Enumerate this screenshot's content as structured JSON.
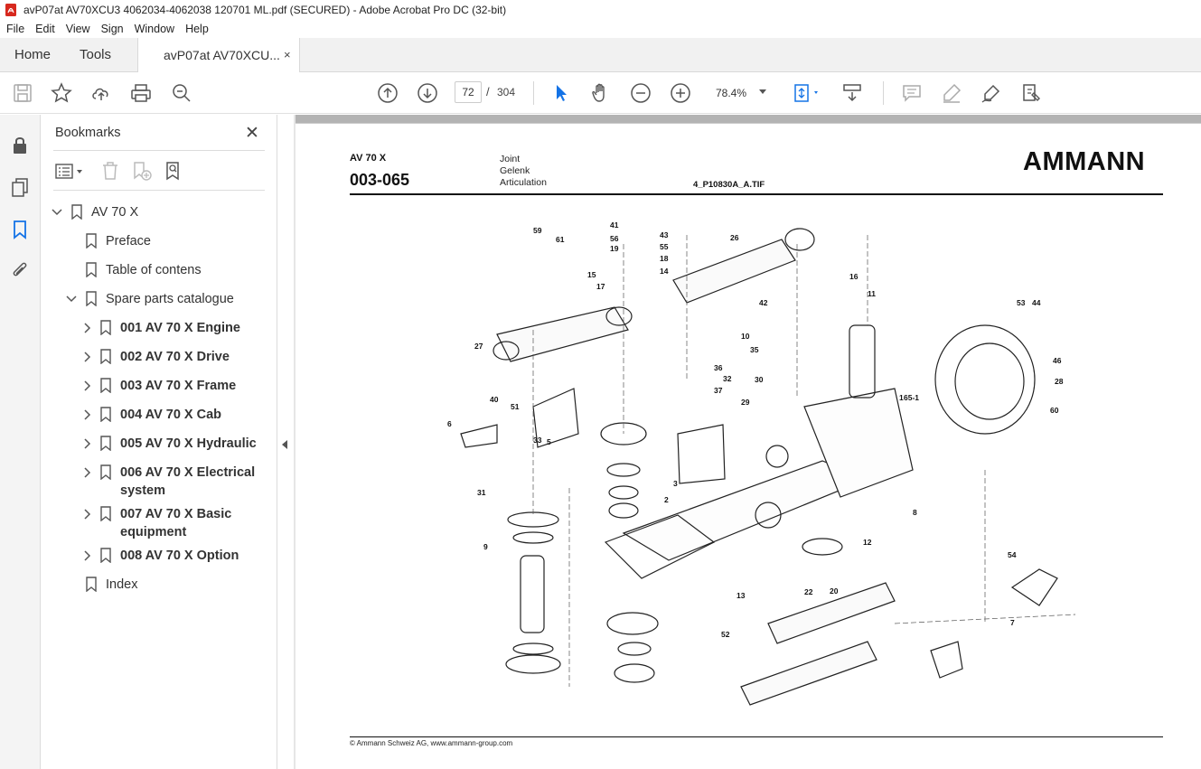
{
  "window": {
    "title": "avP07at AV70XCU3 4062034-4062038 120701 ML.pdf (SECURED) - Adobe Acrobat Pro DC (32-bit)"
  },
  "menu": [
    "File",
    "Edit",
    "View",
    "Sign",
    "Window",
    "Help"
  ],
  "tabs": {
    "home": "Home",
    "tools": "Tools",
    "document": "avP07at AV70XCU...",
    "close_glyph": "×"
  },
  "toolbar": {
    "page_current": "72",
    "page_separator": "/",
    "page_total": "304",
    "zoom": "78.4%"
  },
  "bookmarks": {
    "title": "Bookmarks",
    "close_glyph": "✕",
    "items": [
      {
        "label": "AV 70 X",
        "expanded": true,
        "bold": false
      },
      {
        "label": "Preface",
        "bold": false
      },
      {
        "label": "Table of contens",
        "bold": false
      },
      {
        "label": "Spare parts catalogue",
        "expanded": true,
        "bold": false
      },
      {
        "label": "001  AV 70 X Engine",
        "bold": true
      },
      {
        "label": "002  AV 70 X Drive",
        "bold": true
      },
      {
        "label": "003  AV 70 X Frame",
        "bold": true
      },
      {
        "label": "004  AV 70 X Cab",
        "bold": true
      },
      {
        "label": "005  AV 70 X Hydraulic",
        "bold": true
      },
      {
        "label": "006  AV 70 X Electrical",
        "label2": "system",
        "bold": true
      },
      {
        "label": "007  AV 70 X Basic",
        "label2": "equipment",
        "bold": true
      },
      {
        "label": "008  AV 70 X Option",
        "bold": true
      },
      {
        "label": "Index",
        "bold": false
      }
    ]
  },
  "pdf_page": {
    "model": "AV 70 X",
    "code": "003-065",
    "desc": [
      "Joint",
      "Gelenk",
      "Articulation"
    ],
    "file": "4_P10830A_A.TIF",
    "logo": "AMMANN",
    "footer": "© Ammann Schweiz AG, www.ammann-group.com",
    "part_labels": [
      "41",
      "59",
      "56",
      "61",
      "19",
      "15",
      "17",
      "43",
      "55",
      "18",
      "14",
      "26",
      "16",
      "11",
      "10",
      "35",
      "36",
      "32",
      "37",
      "29",
      "30",
      "42",
      "27",
      "51",
      "40",
      "6",
      "5",
      "33",
      "3",
      "1",
      "2",
      "31",
      "9",
      "65-1",
      "53",
      "44",
      "46",
      "28",
      "60",
      "54",
      "7",
      "8",
      "12",
      "13",
      "20",
      "22",
      "52"
    ]
  },
  "colors": {
    "acrobat_red": "#d7281e",
    "accent_blue": "#1473e6"
  }
}
